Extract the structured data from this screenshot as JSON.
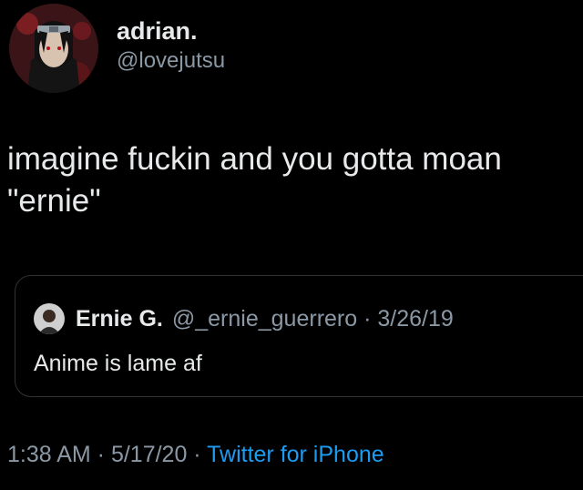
{
  "tweet": {
    "author": {
      "display_name": "adrian.",
      "handle": "@lovejutsu",
      "avatar_icon": "anime-character-avatar"
    },
    "text": "imagine fuckin and you gotta moan\n\"ernie\"",
    "quoted_tweet": {
      "display_name": "Ernie G.",
      "meta": "@_ernie_guerrero · 3/26/19",
      "text": "Anime is lame af",
      "avatar_icon": "user-avatar"
    },
    "footer": {
      "time_date": "1:38 AM · 5/17/20 · ",
      "source": "Twitter for iPhone"
    }
  },
  "colors": {
    "background": "#000000",
    "primary_text": "#e7e9ea",
    "secondary_text": "#8b98a5",
    "link": "#1d9bf0",
    "border": "#2f3336"
  }
}
